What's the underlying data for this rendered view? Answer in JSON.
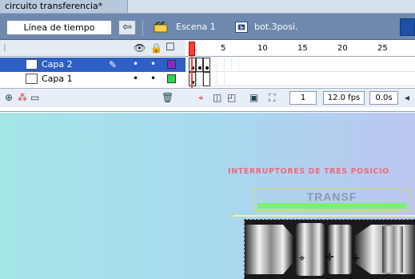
{
  "document": {
    "tab_title": "circuito transferencia*"
  },
  "editbar": {
    "timeline_button": "Línea de tiempo",
    "back_icon": "arrow-left-icon",
    "scene_icon": "clapper-icon",
    "scene_label": "Escena 1",
    "symbol_icon": "button-symbol-icon",
    "symbol_label": "bot.3posi."
  },
  "timeline": {
    "header_icons": [
      "eye-icon",
      "lock-icon",
      "outline-square-icon"
    ],
    "ruler_numbers": [
      "1",
      "5",
      "10",
      "15",
      "20",
      "25"
    ],
    "layers": [
      {
        "name": "Capa 2",
        "selected": true,
        "outline_color": "#8b25d6"
      },
      {
        "name": "Capa 1",
        "selected": false,
        "outline_color": "#2ad84a"
      }
    ],
    "footer": {
      "current_frame": "1",
      "frame_rate": "12.0 fps",
      "elapsed_time": "0.0s"
    }
  },
  "stage": {
    "title_text": "INTERRUPTORES DE TRES POSICIO",
    "label_text": "TRANSF",
    "background_left": "#a4e6e8",
    "background_right": "#bcc6f0"
  }
}
